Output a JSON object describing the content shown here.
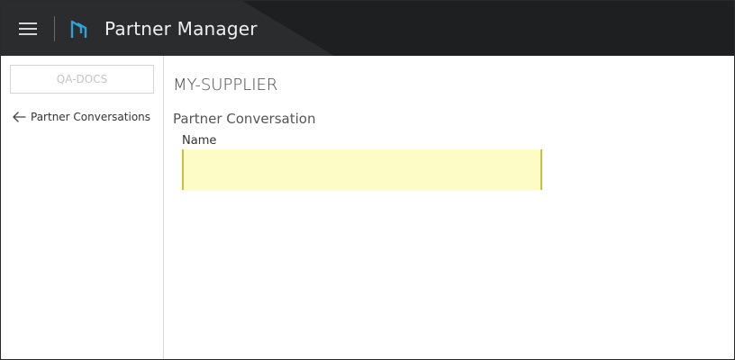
{
  "header": {
    "app_title": "Partner Manager",
    "menu_icon": "hamburger-menu-icon",
    "logo_icon": "app-logo-icon",
    "background_color": "#1e1f20",
    "accent_color": "#2fa3d6"
  },
  "sidebar": {
    "org_label": "QA-DOCS",
    "back_link": {
      "icon": "arrow-left-icon",
      "label": "Partner Conversations"
    }
  },
  "main": {
    "supplier_name": "MY-SUPPLIER",
    "section_title": "Partner Conversation",
    "name_field": {
      "label": "Name",
      "value": "",
      "highlight_color": "#fefcc6"
    }
  }
}
